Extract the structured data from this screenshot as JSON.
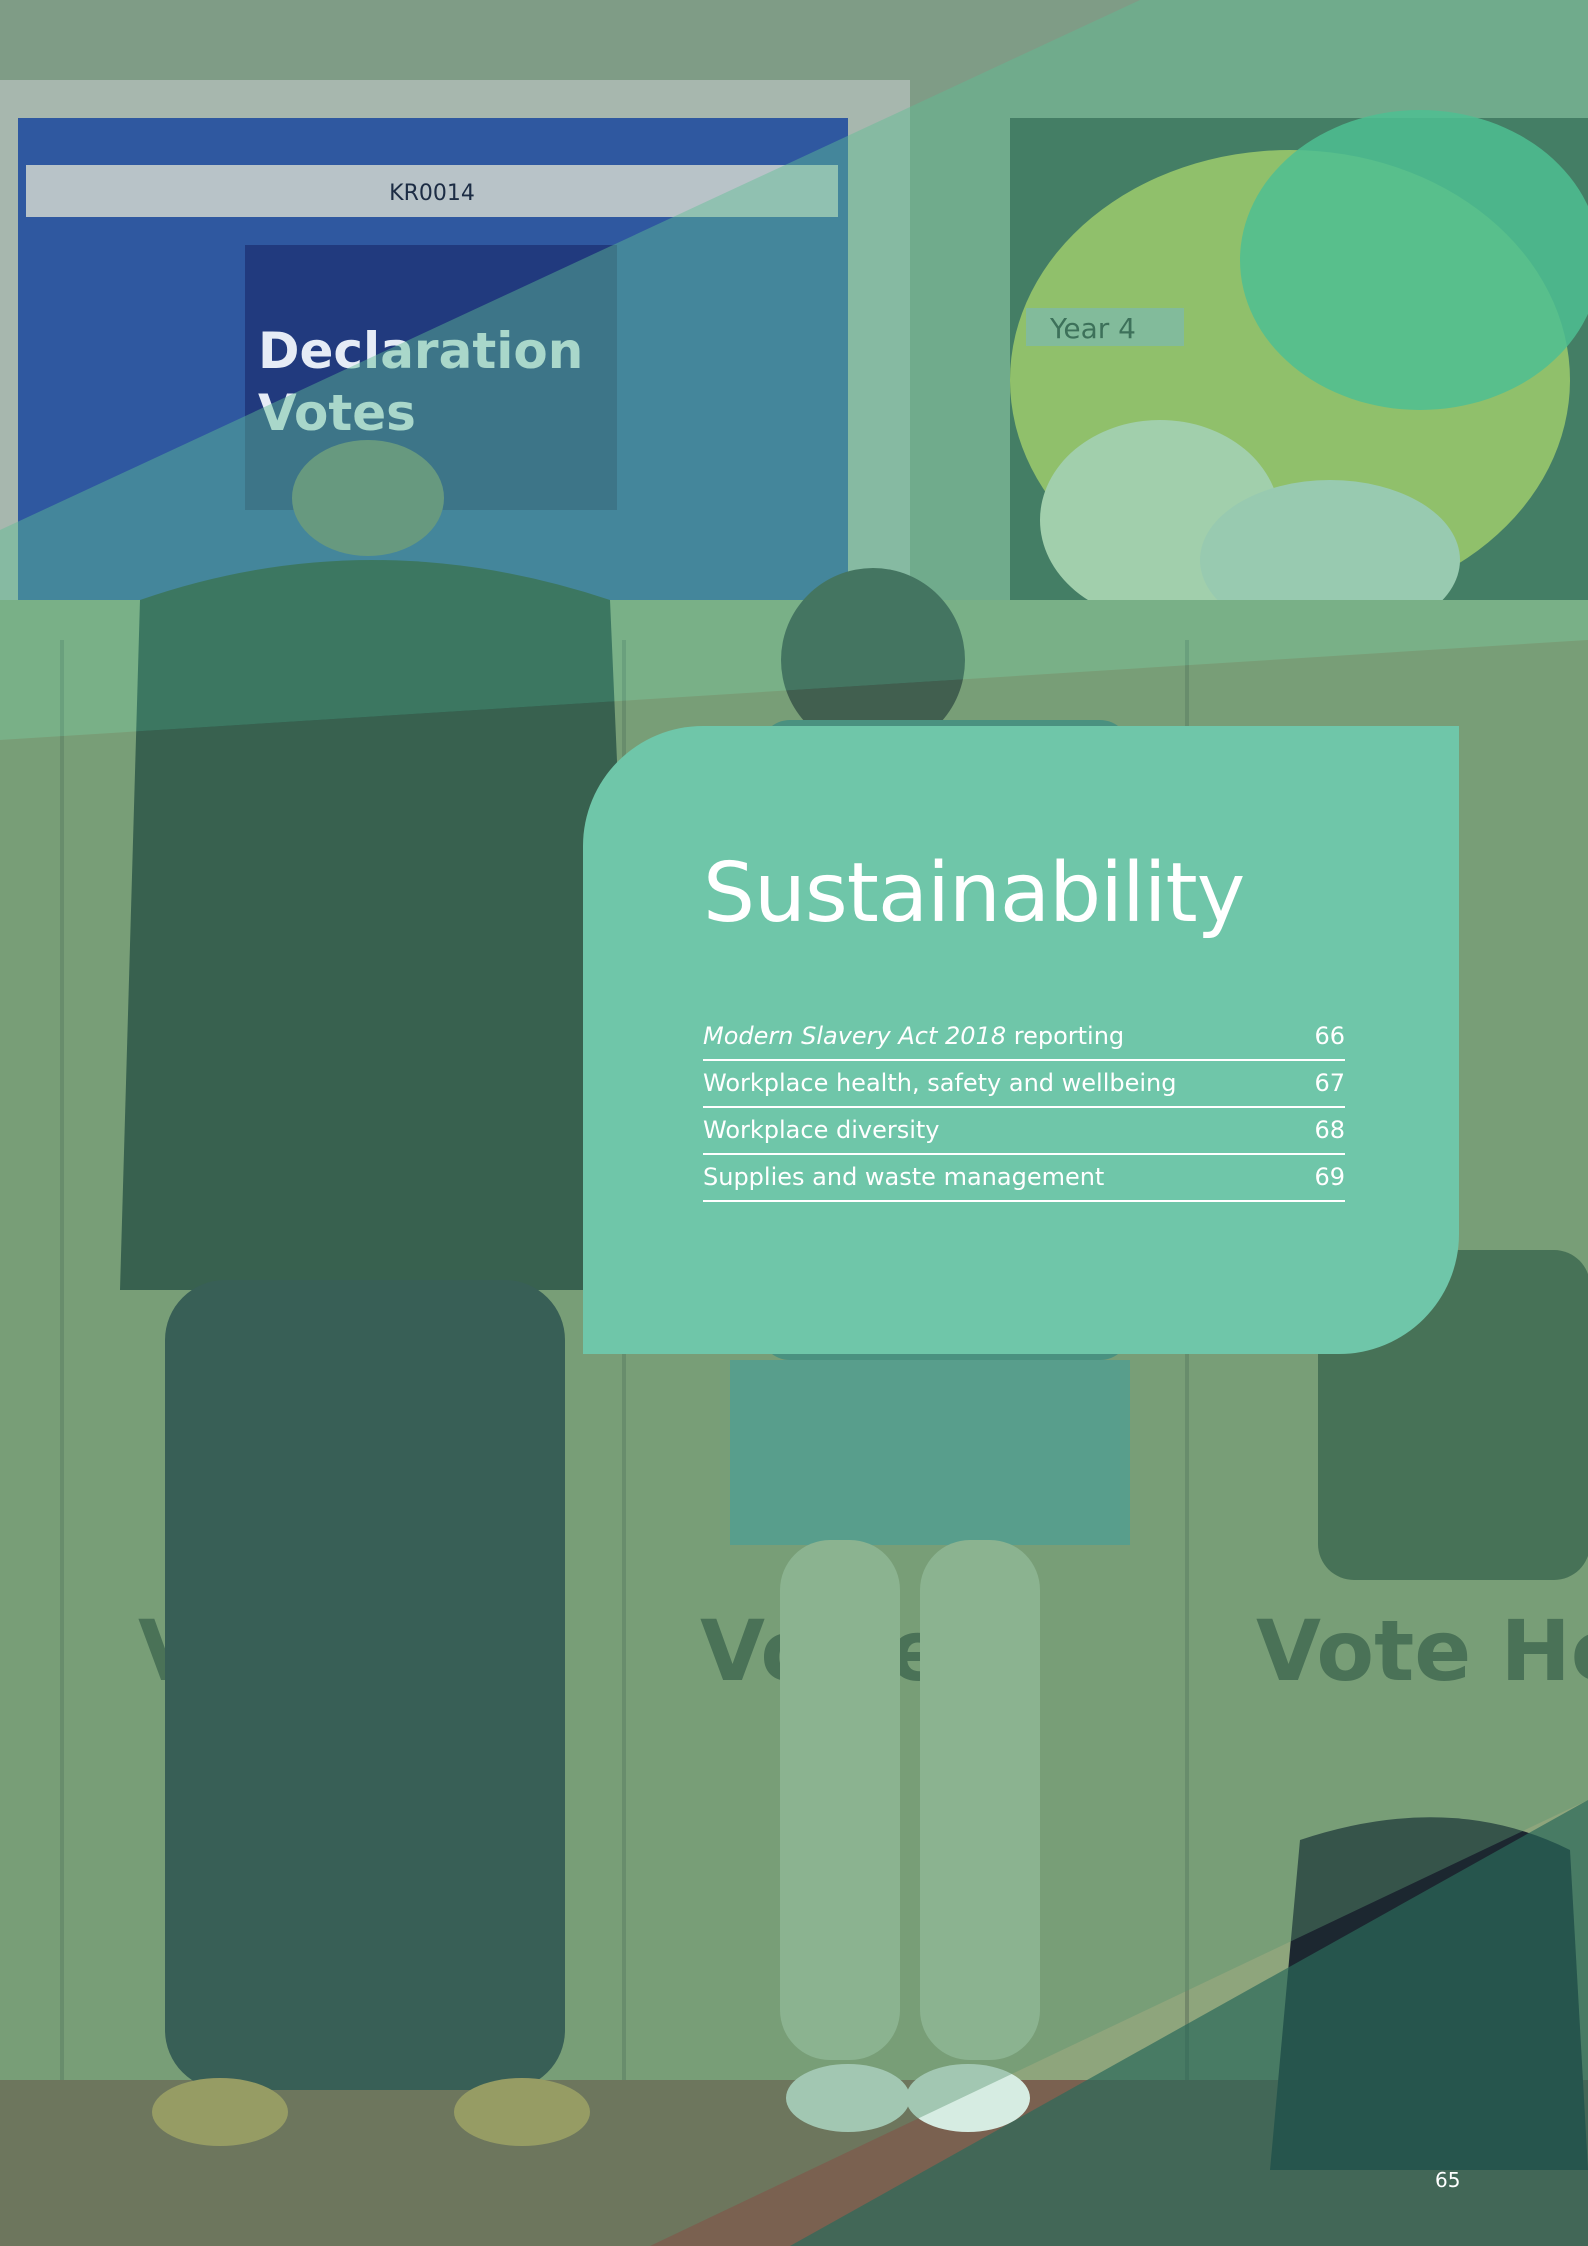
{
  "photo": {
    "door_label": "KR0014",
    "door_sign": [
      "Declaration",
      "Votes"
    ],
    "board_label": "Year 4",
    "booth_signs": [
      "Vo",
      "Vo re",
      "Vote He"
    ]
  },
  "section": {
    "title": "Sustainability",
    "contents": [
      {
        "label_italic": "Modern Slavery Act 2018",
        "label": " reporting",
        "page": "66"
      },
      {
        "label_italic": "",
        "label": "Workplace health, safety and wellbeing",
        "page": "67"
      },
      {
        "label_italic": "",
        "label": "Workplace diversity",
        "page": "68"
      },
      {
        "label_italic": "",
        "label": "Supplies and waste management",
        "page": "69"
      }
    ]
  },
  "footer": {
    "page_number": "65"
  },
  "colors": {
    "panel": "#6fc6a9",
    "overlay": "#5fbf94"
  }
}
